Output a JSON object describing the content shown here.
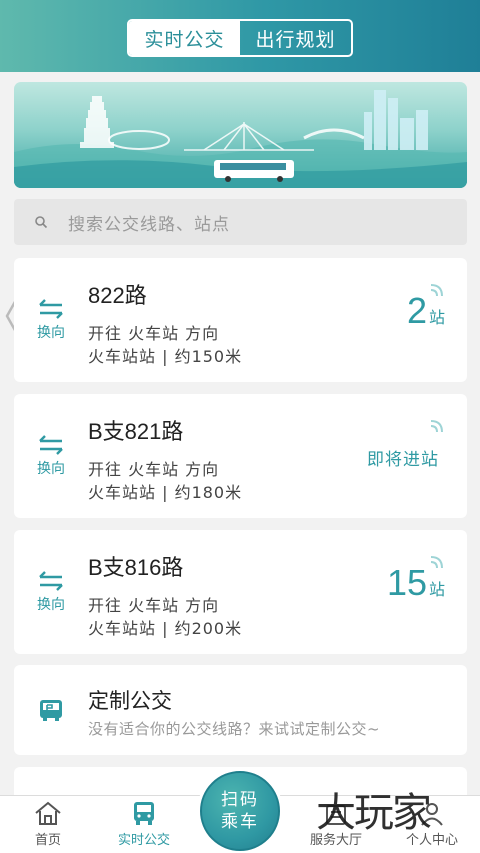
{
  "header": {
    "tabs": [
      {
        "label": "实时公交",
        "active": true
      },
      {
        "label": "出行规划",
        "active": false
      }
    ]
  },
  "search": {
    "placeholder": "搜索公交线路、站点"
  },
  "swap_label": "换向",
  "routes": [
    {
      "name": "822路",
      "direction": "开往 火车站 方向",
      "station": "火车站站 | 约150米",
      "eta_num": "2",
      "eta_unit": "站"
    },
    {
      "name": "B支821路",
      "direction": "开往 火车站 方向",
      "station": "火车站站 | 约180米",
      "eta_text": "即将进站"
    },
    {
      "name": "B支816路",
      "direction": "开往 火车站 方向",
      "station": "火车站站 | 约200米",
      "eta_num": "15",
      "eta_unit": "站"
    }
  ],
  "custom_bus": {
    "title": "定制公交",
    "subtitle": "没有适合你的公交线路？来试试定制公交~"
  },
  "bottom_nav": {
    "items": [
      {
        "label": "首页",
        "icon": "home-icon",
        "active": false
      },
      {
        "label": "实时公交",
        "icon": "bus-icon",
        "active": true
      },
      {
        "label": "服务大厅",
        "icon": "service-icon",
        "active": false
      },
      {
        "label": "个人中心",
        "icon": "user-icon",
        "active": false
      }
    ],
    "scan_label_1": "扫码",
    "scan_label_2": "乘车"
  },
  "watermark": "大玩家",
  "colors": {
    "accent": "#2f9aa3",
    "header_start": "#5fb9ad",
    "header_end": "#1f7f97"
  }
}
